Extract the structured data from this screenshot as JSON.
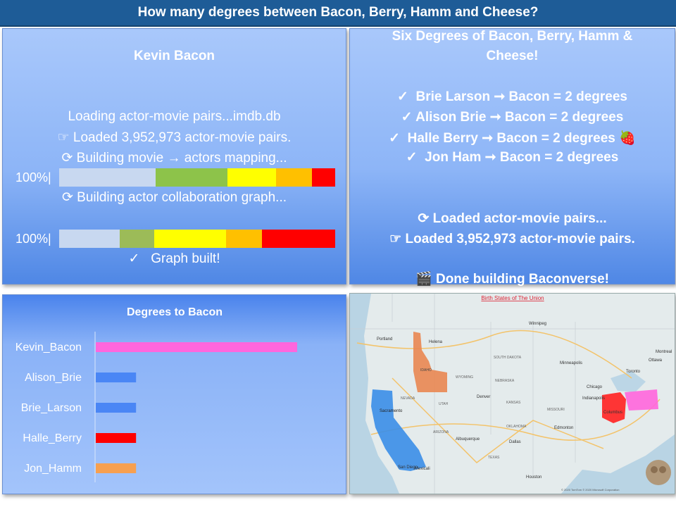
{
  "header": {
    "title": "How many degrees between Bacon, Berry, Hamm and Cheese?"
  },
  "left_panel": {
    "title": "Kevin Bacon",
    "lines": [
      "Loading actor-movie pairs...imdb.db",
      "Loaded 3,952,973 actor-movie pairs.",
      "Building movie → actors mapping...",
      "Building actor collaboration graph...",
      "Graph built!"
    ],
    "progress1": {
      "label": "100%|",
      "value": 1.0
    },
    "progress2": {
      "label": "100%|",
      "value": 1.0
    },
    "colors": [
      "#c8d8f0",
      "#8dc34a",
      "#ffff00",
      "#ffc000",
      "#ff0000"
    ]
  },
  "right_panel": {
    "title_line1": "Six Degrees of Bacon, Berry, Hamm &",
    "title_line2": "Cheese!",
    "results": [
      "Brie Larson ➞ Bacon = 2 degrees",
      "Alison Brie ➞ Bacon = 2 degrees",
      "Halle Berry ➞ Bacon = 2 degrees",
      "Jon Ham ➞ Bacon = 2 degrees"
    ],
    "status": [
      "Loaded actor-movie pairs...",
      "Loaded 3,952,973 actor-movie pairs.",
      "Done building Baconverse!"
    ]
  },
  "chart_data": {
    "type": "bar",
    "title": "Degrees to Bacon",
    "categories": [
      "Kevin_Bacon",
      "Alison_Brie",
      "Brie_Larson",
      "Halle_Berry",
      "Jon_Hamm"
    ],
    "values": [
      5,
      1,
      1,
      1,
      1
    ],
    "colors": [
      "#ff66dd",
      "#4a86f5",
      "#4a86f5",
      "#ff0000",
      "#f7a050"
    ],
    "xlabel": "",
    "ylabel": ""
  },
  "map": {
    "title": "Birth States of The Union",
    "labels": [
      "Winnipeg",
      "SOUTH DAKOTA",
      "NEBRASKA",
      "KANSAS",
      "OKLAHOMA",
      "TEXAS",
      "ARIZONA",
      "UTAH",
      "NEVADA",
      "WYOMING",
      "Minneapolis",
      "Chicago",
      "Toronto",
      "Ottawa",
      "Montreal",
      "Indianapolis",
      "Columbus",
      "MISSOURI",
      "Edmonton",
      "Albuquerque",
      "Dallas",
      "Houston",
      "San Diego",
      "Mexicali",
      "Sacramento",
      "Portland",
      "Helena",
      "IDAHO",
      "Denver"
    ],
    "attribution": "© 2020 TomTom © 2020 Microsoft Corporation",
    "highlight_colors": [
      "#3a8ee8",
      "#e98752",
      "#ff2b2b",
      "#ff66dd"
    ]
  }
}
